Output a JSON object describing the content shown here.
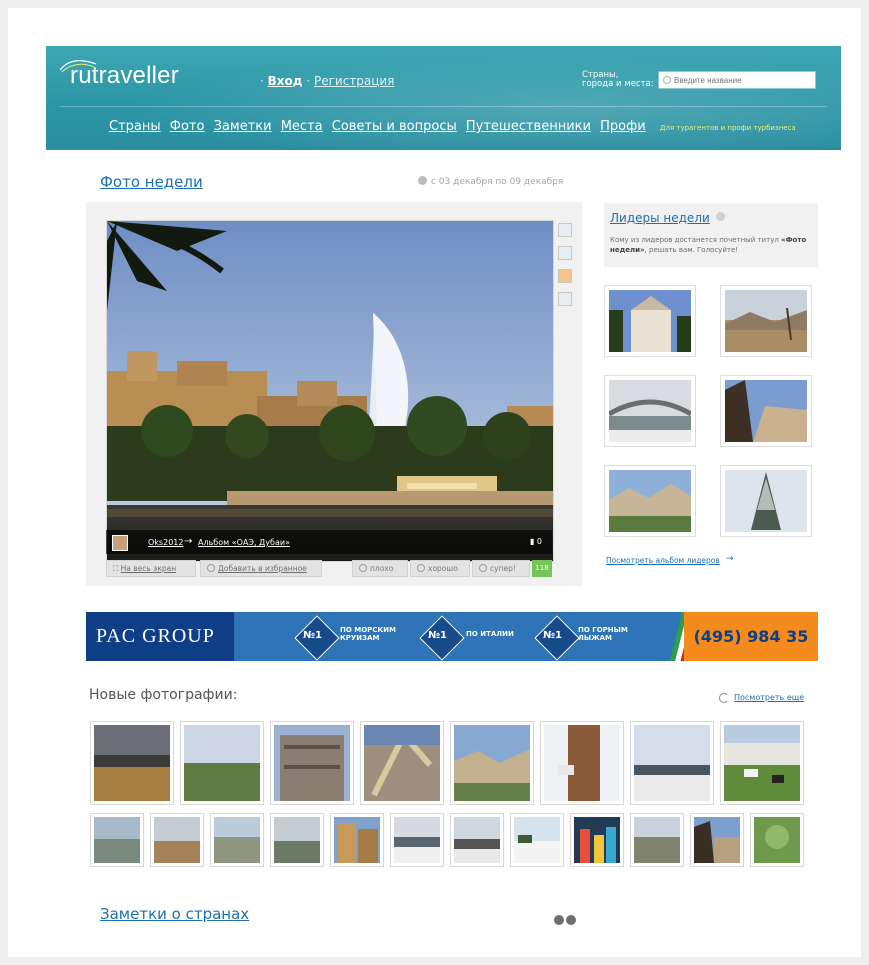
{
  "header": {
    "logo": "rutraveller",
    "auth_sep": "·",
    "login": "Вход",
    "register": "Регистрация",
    "search_label_line1": "Страны,",
    "search_label_line2": "города и места:",
    "search_placeholder": "Введите название",
    "nav": [
      "Страны",
      "Фото",
      "Заметки",
      "Места",
      "Советы и вопросы",
      "Путешественники",
      "Профи"
    ],
    "nav_promo": "Для турагентов и профи турбизнеса"
  },
  "photo_week": {
    "title": "Фото недели",
    "date_range": "с 03 декабря по 09 декабря",
    "author": "Oks2012",
    "arrow": "→",
    "album": "Альбом «ОАЭ, Дубаи»",
    "comment_count": "0",
    "fullscreen": "На весь экран",
    "favorite": "Добавить в избранное",
    "vote_bad": "плохо",
    "vote_good": "хорошо",
    "vote_super": "супер!",
    "score": "118"
  },
  "leaders": {
    "title": "Лидеры недели",
    "desc_part1": "Кому из лидеров достанется почетный титул ",
    "desc_bold": "«Фото недели»",
    "desc_part2": ", решать вам. Голосуйте!",
    "link": "Посмотреть альбом лидеров",
    "link_arrow": "→"
  },
  "banner": {
    "brand": "PAC GROUP",
    "no1": "№1",
    "badge1": "ПО МОРСКИМ КРУИЗАМ",
    "badge2": "ПО ИТАЛИИ",
    "badge3": "ПО ГОРНЫМ ЛЫЖАМ",
    "phone": "(495) 984 35 16"
  },
  "new_photos": {
    "title": "Новые фотографии:",
    "more": "Посмотреть еще"
  },
  "notes": {
    "title": "Заметки о странах"
  }
}
